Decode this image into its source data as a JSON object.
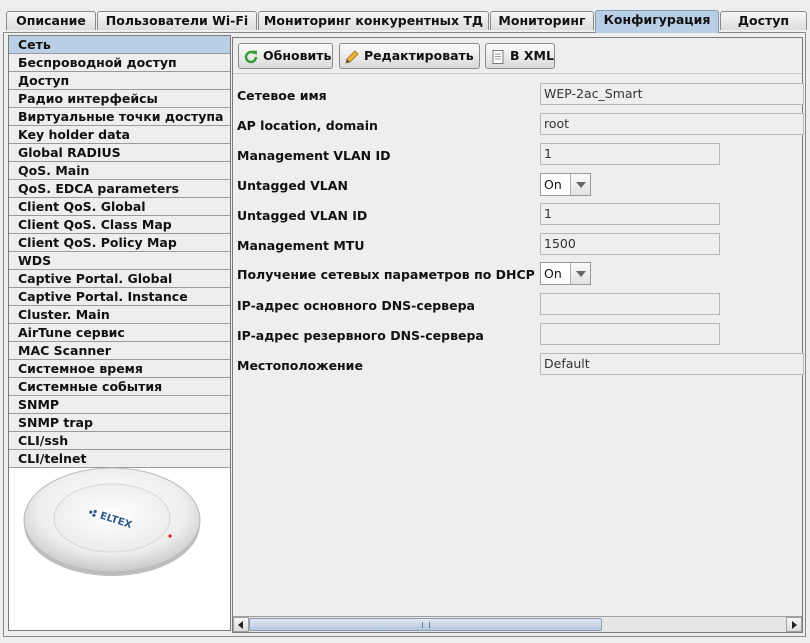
{
  "tabs": [
    {
      "label": "Описание"
    },
    {
      "label": "Пользователи Wi-Fi"
    },
    {
      "label": "Мониторинг конкурентных ТД"
    },
    {
      "label": "Мониторинг"
    },
    {
      "label": "Конфигурация",
      "active": true
    },
    {
      "label": "Доступ"
    }
  ],
  "sidebar": {
    "items": [
      {
        "label": "Сеть",
        "selected": true
      },
      {
        "label": "Беспроводной доступ"
      },
      {
        "label": "Доступ"
      },
      {
        "label": "Радио интерфейсы"
      },
      {
        "label": "Виртуальные точки доступа"
      },
      {
        "label": "Key holder data"
      },
      {
        "label": "Global RADIUS"
      },
      {
        "label": "QoS. Main"
      },
      {
        "label": "QoS. EDCA parameters"
      },
      {
        "label": "Client QoS. Global"
      },
      {
        "label": "Client QoS. Class Map"
      },
      {
        "label": "Client QoS. Policy Map"
      },
      {
        "label": "WDS"
      },
      {
        "label": "Captive Portal. Global"
      },
      {
        "label": "Captive Portal. Instance"
      },
      {
        "label": "Cluster. Main"
      },
      {
        "label": "AirTune сервис"
      },
      {
        "label": "MAC Scanner"
      },
      {
        "label": "Системное время"
      },
      {
        "label": "Системные события"
      },
      {
        "label": "SNMP"
      },
      {
        "label": "SNMP trap"
      },
      {
        "label": "CLI/ssh"
      },
      {
        "label": "CLI/telnet"
      }
    ],
    "device_logo": "ELTEX"
  },
  "toolbar": {
    "refresh_label": "Обновить",
    "edit_label": "Редактировать",
    "xml_label": "В XML",
    "refresh_icon": "refresh-icon",
    "edit_icon": "pencil-icon",
    "xml_icon": "document-icon"
  },
  "form": {
    "network_name": {
      "label": "Сетевое имя",
      "value": "WEP-2ac_Smart"
    },
    "ap_location": {
      "label": "AP location, domain",
      "value": "root"
    },
    "mgmt_vlan_id": {
      "label": "Management VLAN ID",
      "value": "1"
    },
    "untagged_vlan": {
      "label": "Untagged VLAN",
      "value": "On"
    },
    "untagged_vlan_id": {
      "label": "Untagged VLAN ID",
      "value": "1"
    },
    "mgmt_mtu": {
      "label": "Management MTU",
      "value": "1500"
    },
    "dhcp": {
      "label": "Получение сетевых параметров по DHCP",
      "value": "On"
    },
    "primary_dns": {
      "label": "IP-адрес основного DNS-сервера",
      "value": ""
    },
    "secondary_dns": {
      "label": "IP-адрес резервного DNS-сервера",
      "value": ""
    },
    "location": {
      "label": "Местоположение",
      "value": "Default"
    }
  },
  "colors": {
    "selection": "#b8cfe5",
    "background": "#eeeeee",
    "led": "#e0201c"
  }
}
